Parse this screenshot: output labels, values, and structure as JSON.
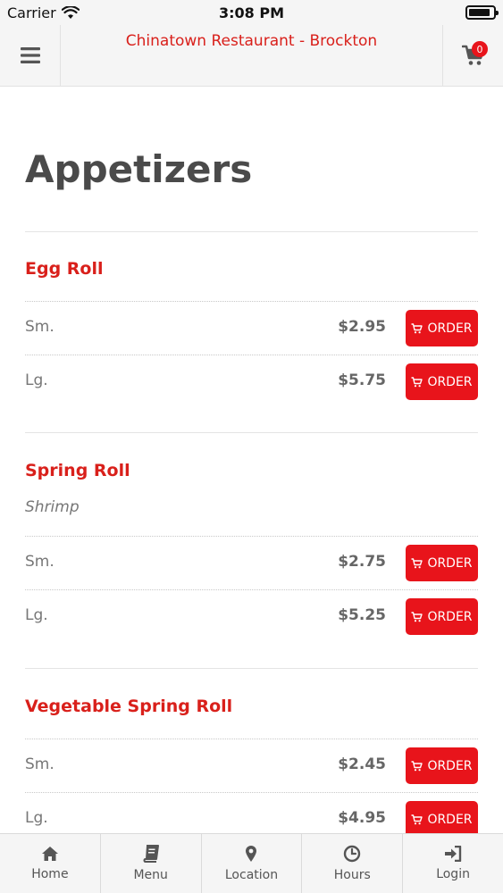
{
  "status_bar": {
    "carrier": "Carrier",
    "time": "3:08 PM",
    "battery_level": 0.9
  },
  "header": {
    "title": "Chinatown Restaurant - Brockton",
    "cart_count": "0"
  },
  "page": {
    "title": "Appetizers"
  },
  "items": [
    {
      "name": "Egg Roll",
      "description": "",
      "prices": [
        {
          "size": "Sm.",
          "price": "$2.95",
          "order_label": "ORDER"
        },
        {
          "size": "Lg.",
          "price": "$5.75",
          "order_label": "ORDER"
        }
      ]
    },
    {
      "name": "Spring Roll",
      "description": "Shrimp",
      "prices": [
        {
          "size": "Sm.",
          "price": "$2.75",
          "order_label": "ORDER"
        },
        {
          "size": "Lg.",
          "price": "$5.25",
          "order_label": "ORDER"
        }
      ]
    },
    {
      "name": "Vegetable Spring Roll",
      "description": "",
      "prices": [
        {
          "size": "Sm.",
          "price": "$2.45",
          "order_label": "ORDER"
        },
        {
          "size": "Lg.",
          "price": "$4.95",
          "order_label": "ORDER"
        }
      ]
    }
  ],
  "tabs": [
    {
      "label": "Home",
      "icon": "home-icon"
    },
    {
      "label": "Menu",
      "icon": "book-icon"
    },
    {
      "label": "Location",
      "icon": "map-pin-icon"
    },
    {
      "label": "Hours",
      "icon": "clock-icon"
    },
    {
      "label": "Login",
      "icon": "sign-in-icon"
    }
  ],
  "colors": {
    "accent": "#e8141b",
    "title_red": "#d9201b",
    "text_gray": "#555555"
  }
}
